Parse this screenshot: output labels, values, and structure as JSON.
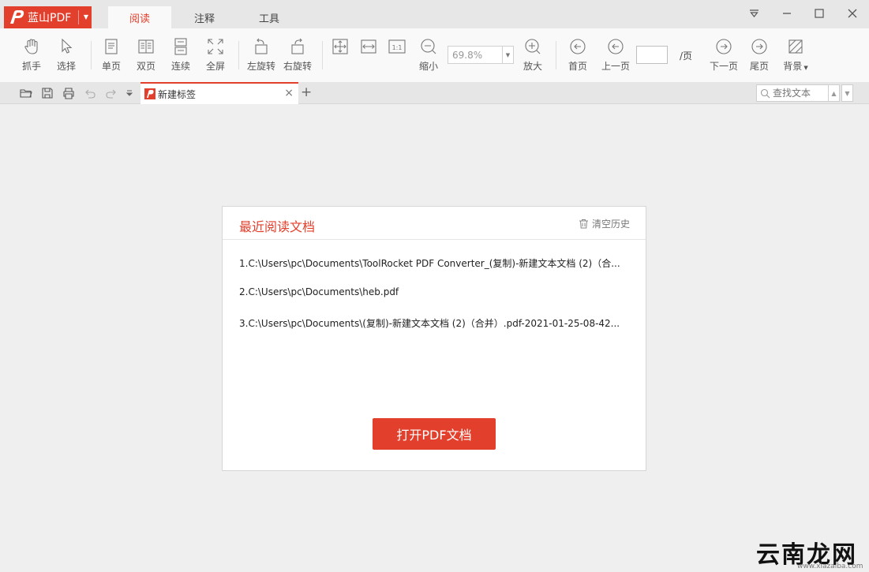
{
  "app": {
    "name": "蓝山PDF",
    "brand_color": "#e23f2c"
  },
  "menu_tabs": [
    {
      "label": "阅读",
      "active": true
    },
    {
      "label": "注释",
      "active": false
    },
    {
      "label": "工具",
      "active": false
    }
  ],
  "window_controls": [
    "dropdown-icon",
    "minimize-icon",
    "maximize-icon",
    "close-icon"
  ],
  "toolbar": {
    "hand": "抓手",
    "select": "选择",
    "single": "单页",
    "double": "双页",
    "continuous": "连续",
    "fullscreen": "全屏",
    "rotate_left": "左旋转",
    "rotate_right": "右旋转",
    "zoom_out": "缩小",
    "zoom_value": "69.8%",
    "zoom_in": "放大",
    "first": "首页",
    "prev": "上一页",
    "page_value": "",
    "page_suffix": "/页",
    "next": "下一页",
    "last": "尾页",
    "background": "背景"
  },
  "tab": {
    "label": "新建标签",
    "close": "×",
    "new": "+"
  },
  "search": {
    "placeholder": "查找文本"
  },
  "recent": {
    "title": "最近阅读文档",
    "clear": "清空历史",
    "files": [
      "1.C:\\Users\\pc\\Documents\\ToolRocket PDF Converter_(复制)-新建文本文档 (2)（合...",
      "2.C:\\Users\\pc\\Documents\\heb.pdf",
      "3.C:\\Users\\pc\\Documents\\(复制)-新建文本文档 (2)（合并）.pdf-2021-01-25-08-42..."
    ],
    "open_button": "打开PDF文档"
  },
  "watermark": {
    "text": "云南龙网",
    "sub": "www.xiazaiba.com"
  }
}
